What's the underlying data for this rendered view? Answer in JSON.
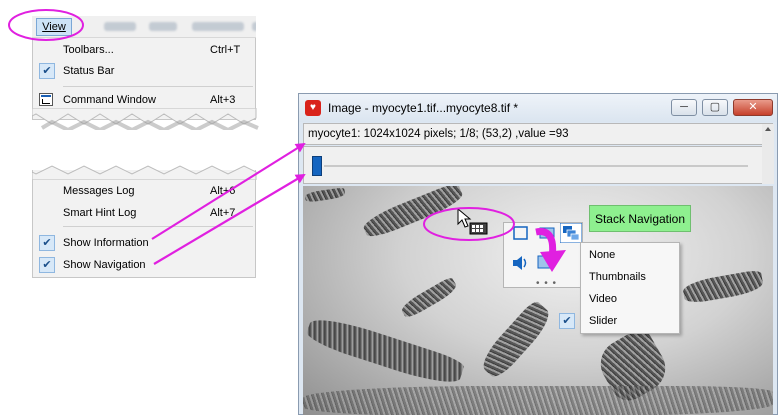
{
  "menu": {
    "bar_label": "View",
    "items_top": [
      {
        "label": "Toolbars...",
        "shortcut": "Ctrl+T"
      },
      {
        "label": "Status Bar",
        "shortcut": ""
      },
      {
        "label": "Command Window",
        "shortcut": "Alt+3"
      }
    ],
    "items_bottom": [
      {
        "label": "Messages Log",
        "shortcut": "Alt+6"
      },
      {
        "label": "Smart Hint Log",
        "shortcut": "Alt+7"
      },
      {
        "label": "Show Information",
        "shortcut": ""
      },
      {
        "label": "Show Navigation",
        "shortcut": ""
      }
    ]
  },
  "window": {
    "title": "Image - myocyte1.tif...myocyte8.tif *",
    "info": "myocyte1: 1024x1024 pixels; 1/8; (53,2) ,value =93",
    "min_glyph": "─",
    "max_glyph": "▢",
    "close_glyph": "✕"
  },
  "tooltip": "Stack Navigation",
  "nav_menu": {
    "items": [
      "None",
      "Thumbnails",
      "Video",
      "Slider"
    ],
    "checked": "Slider"
  },
  "colors": {
    "highlight": "#e020e0",
    "accent_blue": "#1565c0",
    "tooltip_green": "#8ef08f"
  }
}
